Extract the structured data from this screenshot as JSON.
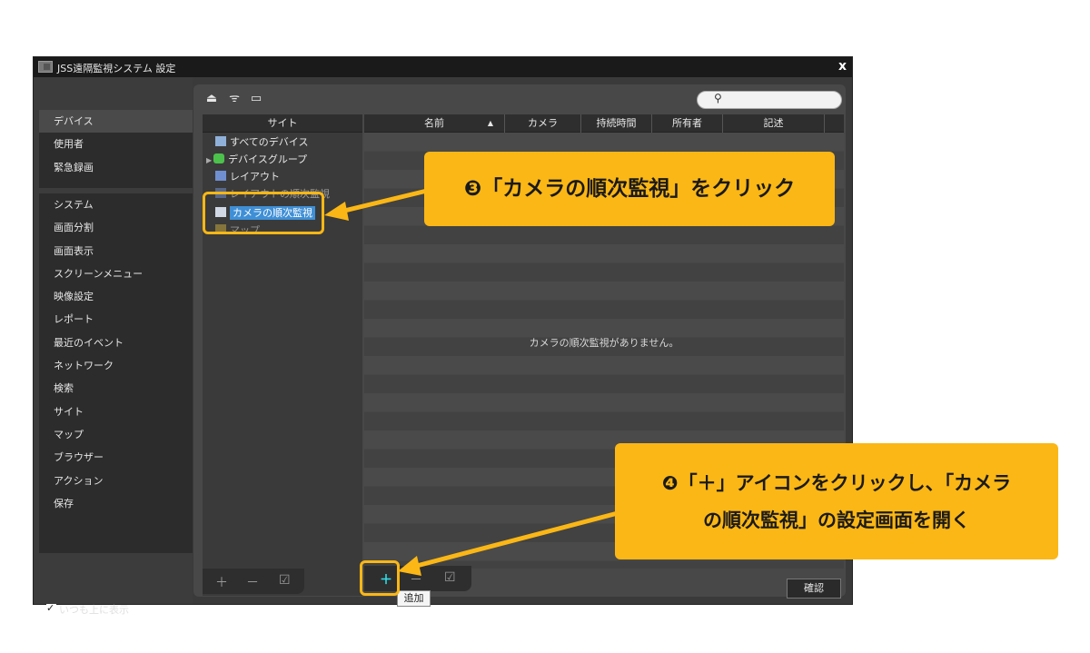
{
  "window": {
    "title": "JSS遠隔監視システム 設定",
    "close": "x"
  },
  "nav": {
    "group1": [
      "デバイス",
      "使用者",
      "緊急録画"
    ],
    "group2": [
      "システム",
      "画面分割",
      "画面表示",
      "スクリーンメニュー",
      "映像設定",
      "レポート",
      "最近のイベント",
      "ネットワーク",
      "検索",
      "サイト",
      "マップ",
      "ブラウザー",
      "アクション",
      "保存"
    ],
    "selected": "デバイス"
  },
  "always_on_top": "いつも上に表示",
  "site_panel": {
    "header": "サイト",
    "tree": [
      {
        "label": "すべてのデバイス",
        "icon": "devices-icon"
      },
      {
        "label": "デバイスグループ",
        "icon": "device-group-icon"
      },
      {
        "label": "レイアウト",
        "icon": "layout-icon"
      },
      {
        "label": "レイアウトの順次監視",
        "icon": "layout-sequence-icon"
      },
      {
        "label": "カメラの順次監視",
        "icon": "camera-sequence-icon"
      },
      {
        "label": "マップ",
        "icon": "map-icon"
      }
    ]
  },
  "list": {
    "columns": [
      "名前",
      "カメラ",
      "持続時間",
      "所有者",
      "記述"
    ],
    "empty_message": "カメラの順次監視がありません。"
  },
  "buttons": {
    "confirm": "確認",
    "add_tooltip": "追加"
  },
  "callouts": {
    "step3": "❸「カメラの順次監視」をクリック",
    "step4_line1": "❹「＋」アイコンをクリックし、「カメラ",
    "step4_line2": "の順次監視」の設定画面を開く"
  },
  "colors": {
    "accent": "#fbb715",
    "selection": "#3f8fd6",
    "add_icon": "#2ee0e8"
  }
}
